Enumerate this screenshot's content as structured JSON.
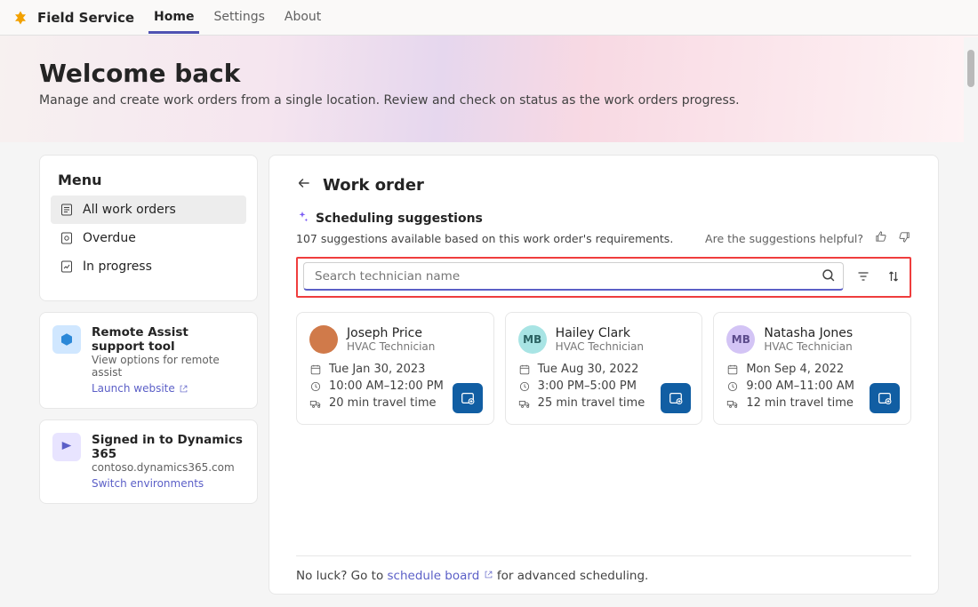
{
  "appName": "Field Service",
  "nav": {
    "home": "Home",
    "settings": "Settings",
    "about": "About"
  },
  "hero": {
    "title": "Welcome back",
    "subtitle": "Manage and create work orders from a single location. Review and check on status as the work orders progress."
  },
  "menu": {
    "title": "Menu",
    "items": [
      {
        "label": "All work orders"
      },
      {
        "label": "Overdue"
      },
      {
        "label": "In progress"
      }
    ]
  },
  "infoCards": [
    {
      "title": "Remote Assist support tool",
      "sub": "View options for remote assist",
      "link": "Launch website"
    },
    {
      "title": "Signed in to Dynamics 365",
      "sub": "contoso.dynamics365.com",
      "link": "Switch environments"
    }
  ],
  "workOrder": {
    "title": "Work order",
    "suggestionsLabel": "Scheduling suggestions",
    "suggestionsCount": "107 suggestions available based on this work order's requirements.",
    "helpfulPrompt": "Are the suggestions helpful?",
    "searchPlaceholder": "Search technician name",
    "technicians": [
      {
        "name": "Joseph Price",
        "role": "HVAC Technician",
        "date": "Tue Jan 30, 2023",
        "time": "10:00 AM–12:00 PM",
        "travel": "20 min travel time",
        "avatarType": "photo",
        "initials": ""
      },
      {
        "name": "Hailey Clark",
        "role": "HVAC Technician",
        "date": "Tue Aug 30, 2022",
        "time": "3:00 PM–5:00 PM",
        "travel": "25 min travel time",
        "avatarType": "mb",
        "initials": "MB"
      },
      {
        "name": "Natasha Jones",
        "role": "HVAC Technician",
        "date": "Mon Sep 4, 2022",
        "time": "9:00 AM–11:00 AM",
        "travel": "12 min travel time",
        "avatarType": "lav",
        "initials": "MB"
      }
    ],
    "footerPrefix": "No luck? Go to ",
    "footerLink": "schedule board",
    "footerSuffix": " for advanced scheduling."
  }
}
